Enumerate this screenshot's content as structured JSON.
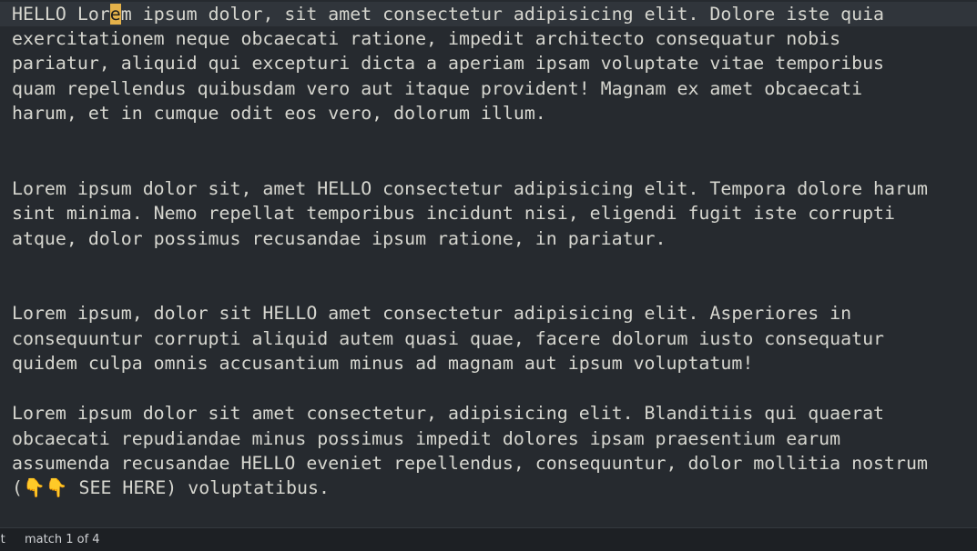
{
  "editor": {
    "lines": [
      {
        "before": "HELLO Lor",
        "cursor": "e",
        "after": "m ipsum dolor, sit amet consectetur adipisicing elit. Dolore iste quia"
      },
      {
        "text": "exercitationem neque obcaecati ratione, impedit architecto consequatur nobis"
      },
      {
        "text": "pariatur, aliquid qui excepturi dicta a aperiam ipsam voluptate vitae temporibus"
      },
      {
        "text": "quam repellendus quibusdam vero aut itaque provident! Magnam ex amet obcaecati"
      },
      {
        "text": "harum, et in cumque odit eos vero, dolorum illum."
      },
      {
        "text": "Lorem ipsum dolor sit, amet HELLO consectetur adipisicing elit. Tempora dolore harum"
      },
      {
        "text": "sint minima. Nemo repellat temporibus incidunt nisi, eligendi fugit iste corrupti"
      },
      {
        "text": "atque, dolor possimus recusandae ipsum ratione, in pariatur."
      },
      {
        "text": "Lorem ipsum, dolor sit HELLO amet consectetur adipisicing elit. Asperiores in"
      },
      {
        "text": "consequuntur corrupti aliquid autem quasi quae, facere dolorum iusto consequatur"
      },
      {
        "text": "quidem culpa omnis accusantium minus ad magnam aut ipsum voluptatum!"
      },
      {
        "text": "Lorem ipsum dolor sit amet consectetur, adipisicing elit. Blanditiis qui quaerat"
      },
      {
        "text": "obcaecati repudiandae minus possimus impedit dolores ipsam praesentium earum"
      },
      {
        "text": "assumenda recusandae HELLO eveniet repellendus, consequuntur, dolor mollitia nostrum"
      },
      {
        "before": "(",
        "emoji": "👇👇",
        "after": " SEE HERE) voluptatibus."
      }
    ]
  },
  "statusbar": {
    "mode": "it",
    "match": "match 1 of 4"
  },
  "colors": {
    "background": "#262a2f",
    "text": "#d6d6cf",
    "cursor": "#e5b24a",
    "current_line": "#30353b",
    "statusbar_bg": "#1d2024"
  }
}
